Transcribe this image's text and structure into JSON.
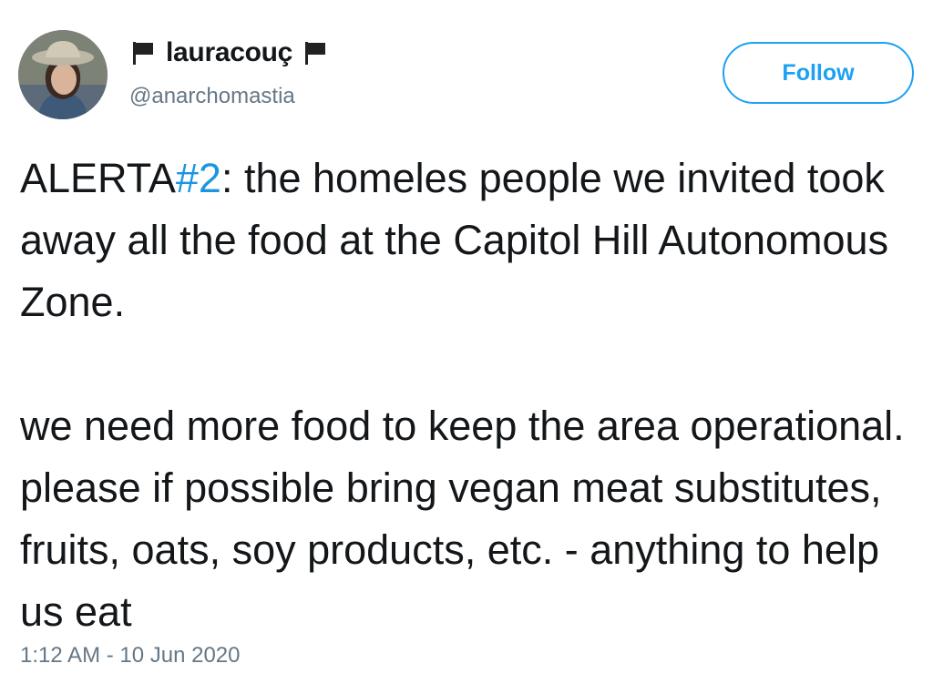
{
  "user": {
    "display_name": "lauracouç",
    "handle": "@anarchomastia",
    "avatar_icon": "avatar-photo",
    "name_decoration_icon": "black-flag-icon"
  },
  "follow_button": {
    "label": "Follow"
  },
  "tweet": {
    "p1_before": "ALERTA",
    "p1_hashtag": "#2",
    "p1_after": ": the homeles people we invited took away all the food at the Capitol Hill Autonomous Zone.",
    "p2": "we need more food to keep the area operational. please if possible bring vegan meat substitutes, fruits, oats, soy products, etc. - anything to help us eat"
  },
  "timestamp": "1:12 AM - 10 Jun 2020",
  "colors": {
    "accent": "#1da1f2",
    "hashtag": "#1b95e0",
    "secondary_text": "#657786",
    "primary_text": "#14171a"
  }
}
